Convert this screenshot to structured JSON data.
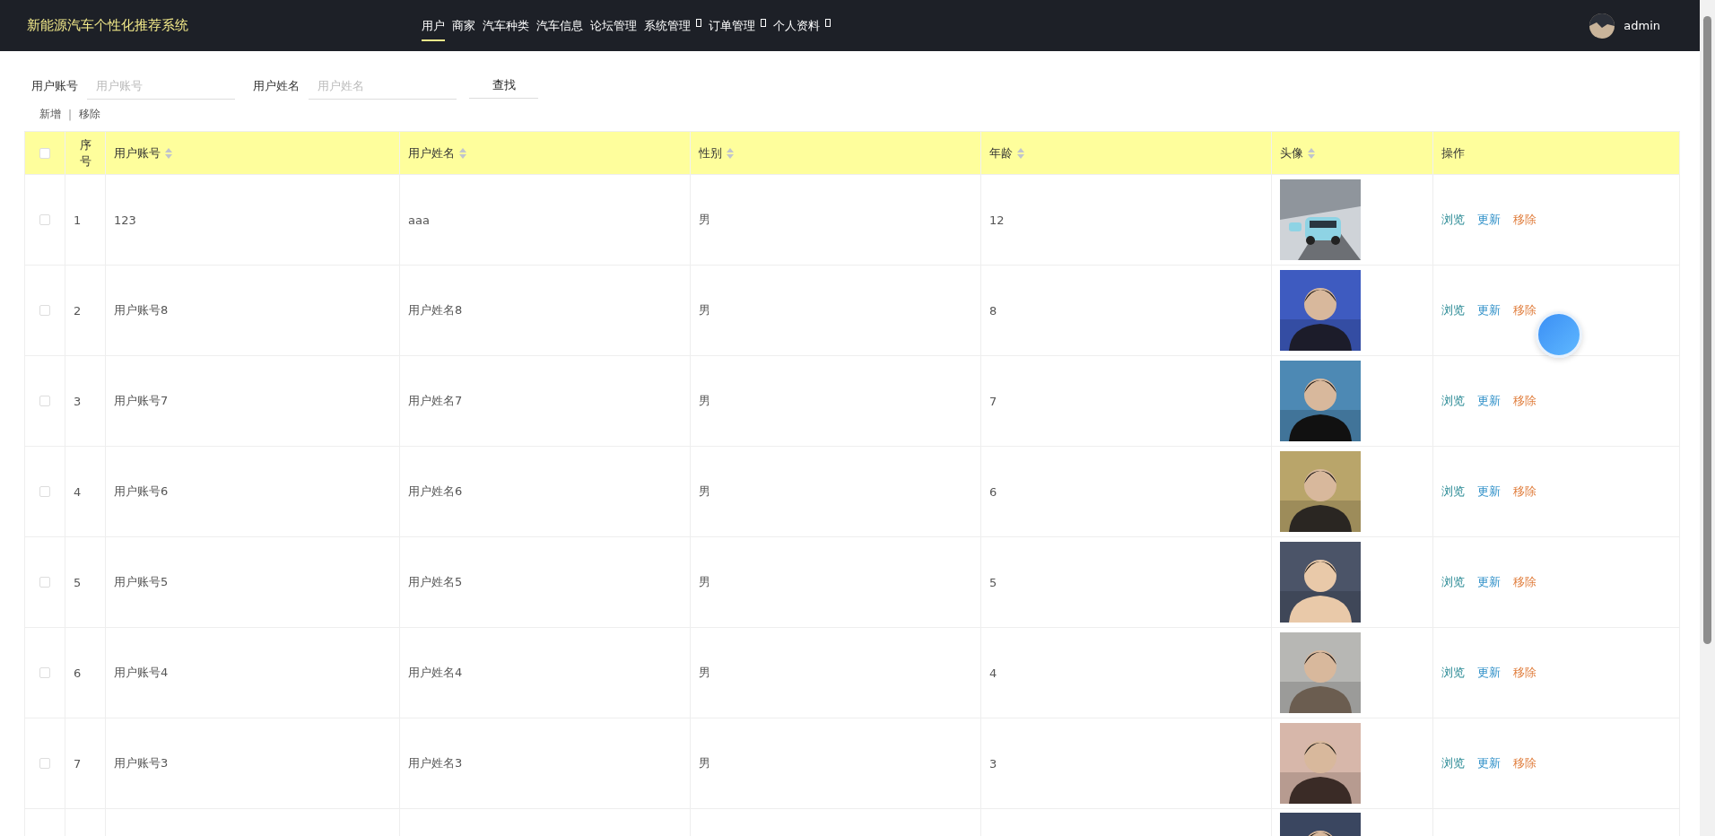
{
  "header": {
    "title": "新能源汽车个性化推荐系统",
    "nav": [
      {
        "label": "用户",
        "selected": true,
        "dropdown": false
      },
      {
        "label": "商家",
        "selected": false,
        "dropdown": false
      },
      {
        "label": "汽车种类",
        "selected": false,
        "dropdown": false
      },
      {
        "label": "汽车信息",
        "selected": false,
        "dropdown": false
      },
      {
        "label": "论坛管理",
        "selected": false,
        "dropdown": false
      },
      {
        "label": "系统管理",
        "selected": false,
        "dropdown": true
      },
      {
        "label": "订单管理",
        "selected": false,
        "dropdown": true
      },
      {
        "label": "个人资料",
        "selected": false,
        "dropdown": true
      }
    ],
    "user": {
      "name": "admin"
    }
  },
  "filters": [
    {
      "label": "用户账号",
      "placeholder": "用户账号"
    },
    {
      "label": "用户姓名",
      "placeholder": "用户姓名"
    }
  ],
  "search_button": "查找",
  "actions": [
    {
      "label": "新增"
    },
    {
      "label": "|",
      "kind": "separator"
    },
    {
      "label": "移除"
    }
  ],
  "table": {
    "select_all_checked": false,
    "columns": [
      {
        "label": "序号",
        "sortable": false
      },
      {
        "label": "用户账号",
        "sortable": true
      },
      {
        "label": "用户姓名",
        "sortable": true
      },
      {
        "label": "性别",
        "sortable": true
      },
      {
        "label": "年龄",
        "sortable": true
      },
      {
        "label": "头像",
        "sortable": true
      },
      {
        "label": "操作",
        "sortable": false
      }
    ],
    "rows": [
      {
        "checked": false,
        "index": "1",
        "account": "123",
        "name": "aaa",
        "gender": "男",
        "age": "12",
        "avatar": {
          "kind": "picture"
        },
        "operations": [
          {
            "label": "浏览",
            "kind": "view"
          },
          {
            "label": "更新",
            "kind": "edit"
          },
          {
            "label": "移除",
            "kind": "delete"
          }
        ]
      },
      {
        "checked": false,
        "index": "2",
        "account": "用户账号8",
        "name": "用户姓名8",
        "gender": "男",
        "age": "8",
        "avatar": {
          "kind": "picture"
        },
        "operations": [
          {
            "label": "浏览",
            "kind": "view"
          },
          {
            "label": "更新",
            "kind": "edit"
          },
          {
            "label": "移除",
            "kind": "delete"
          }
        ]
      },
      {
        "checked": false,
        "index": "3",
        "account": "用户账号7",
        "name": "用户姓名7",
        "gender": "男",
        "age": "7",
        "avatar": {
          "kind": "picture"
        },
        "operations": [
          {
            "label": "浏览",
            "kind": "view"
          },
          {
            "label": "更新",
            "kind": "edit"
          },
          {
            "label": "移除",
            "kind": "delete"
          }
        ]
      },
      {
        "checked": false,
        "index": "4",
        "account": "用户账号6",
        "name": "用户姓名6",
        "gender": "男",
        "age": "6",
        "avatar": {
          "kind": "picture"
        },
        "operations": [
          {
            "label": "浏览",
            "kind": "view"
          },
          {
            "label": "更新",
            "kind": "edit"
          },
          {
            "label": "移除",
            "kind": "delete"
          }
        ]
      },
      {
        "checked": false,
        "index": "5",
        "account": "用户账号5",
        "name": "用户姓名5",
        "gender": "男",
        "age": "5",
        "avatar": {
          "kind": "picture"
        },
        "operations": [
          {
            "label": "浏览",
            "kind": "view"
          },
          {
            "label": "更新",
            "kind": "edit"
          },
          {
            "label": "移除",
            "kind": "delete"
          }
        ]
      },
      {
        "checked": false,
        "index": "6",
        "account": "用户账号4",
        "name": "用户姓名4",
        "gender": "男",
        "age": "4",
        "avatar": {
          "kind": "picture"
        },
        "operations": [
          {
            "label": "浏览",
            "kind": "view"
          },
          {
            "label": "更新",
            "kind": "edit"
          },
          {
            "label": "移除",
            "kind": "delete"
          }
        ]
      },
      {
        "checked": false,
        "index": "7",
        "account": "用户账号3",
        "name": "用户姓名3",
        "gender": "男",
        "age": "3",
        "avatar": {
          "kind": "picture"
        },
        "operations": [
          {
            "label": "浏览",
            "kind": "view"
          },
          {
            "label": "更新",
            "kind": "edit"
          },
          {
            "label": "移除",
            "kind": "delete"
          }
        ]
      },
      {
        "avatar": {
          "kind": "picture"
        }
      }
    ]
  }
}
